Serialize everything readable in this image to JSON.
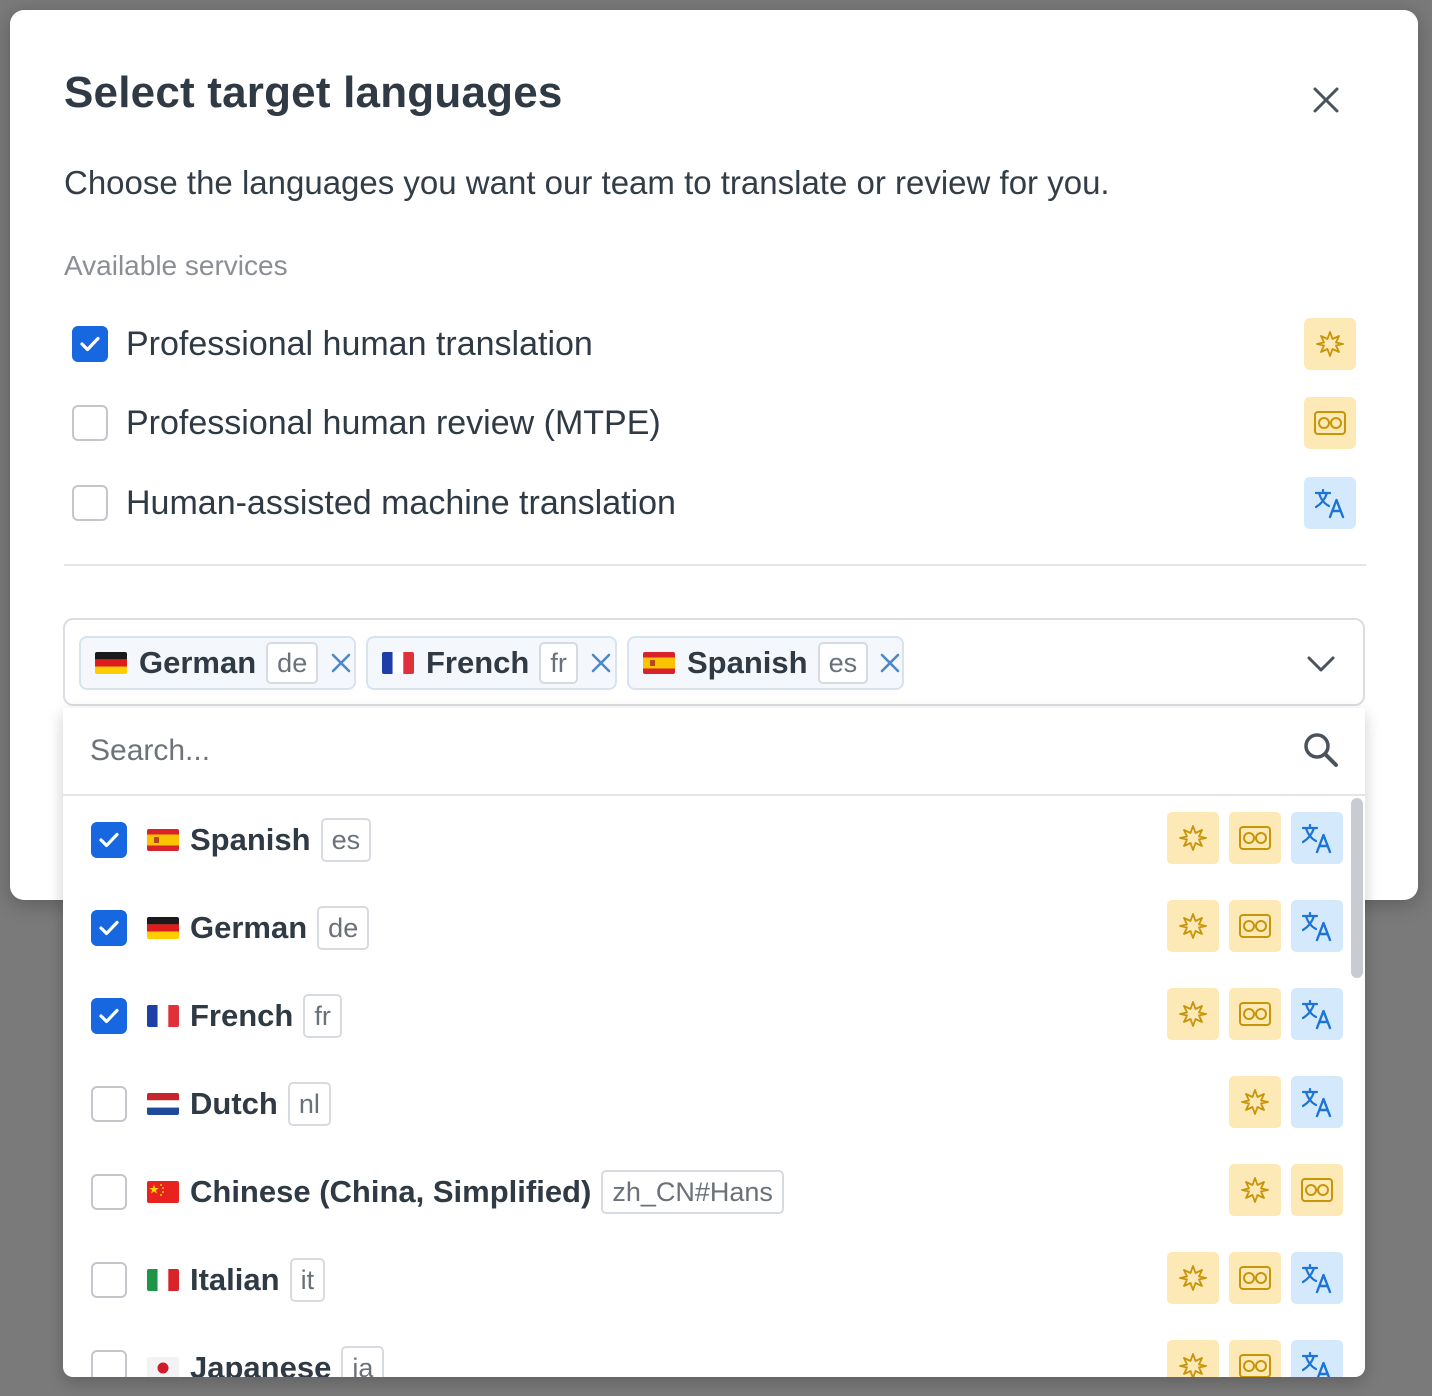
{
  "modal": {
    "title": "Select target languages",
    "subtitle": "Choose the languages you want our team to translate or review for you.",
    "services_label": "Available services",
    "services": [
      {
        "label": "Professional human translation",
        "checked": true,
        "icon": "sparkle-icon",
        "badge_color": "#fde9b5"
      },
      {
        "label": "Professional human review (MTPE)",
        "checked": false,
        "icon": "review-glasses-icon",
        "badge_color": "#fde9b5"
      },
      {
        "label": "Human-assisted machine translation",
        "checked": false,
        "icon": "translate-icon",
        "badge_color": "#d4e9fb"
      }
    ]
  },
  "selected_chips": [
    {
      "name": "German",
      "code": "de",
      "flag": "de-flag-icon"
    },
    {
      "name": "French",
      "code": "fr",
      "flag": "fr-flag-icon"
    },
    {
      "name": "Spanish",
      "code": "es",
      "flag": "es-flag-icon"
    }
  ],
  "search": {
    "placeholder": "Search..."
  },
  "languages": [
    {
      "name": "Spanish",
      "code": "es",
      "checked": true,
      "flag": "es-flag-icon",
      "services": [
        "sparkle-icon",
        "review-glasses-icon",
        "translate-icon"
      ]
    },
    {
      "name": "German",
      "code": "de",
      "checked": true,
      "flag": "de-flag-icon",
      "services": [
        "sparkle-icon",
        "review-glasses-icon",
        "translate-icon"
      ]
    },
    {
      "name": "French",
      "code": "fr",
      "checked": true,
      "flag": "fr-flag-icon",
      "services": [
        "sparkle-icon",
        "review-glasses-icon",
        "translate-icon"
      ]
    },
    {
      "name": "Dutch",
      "code": "nl",
      "checked": false,
      "flag": "nl-flag-icon",
      "services": [
        "sparkle-icon",
        "translate-icon"
      ]
    },
    {
      "name": "Chinese (China, Simplified)",
      "code": "zh_CN#Hans",
      "checked": false,
      "flag": "cn-flag-icon",
      "services": [
        "sparkle-icon",
        "review-glasses-icon"
      ]
    },
    {
      "name": "Italian",
      "code": "it",
      "checked": false,
      "flag": "it-flag-icon",
      "services": [
        "sparkle-icon",
        "review-glasses-icon",
        "translate-icon"
      ]
    },
    {
      "name": "Japanese",
      "code": "ja",
      "checked": false,
      "flag": "jp-flag-icon",
      "services": [
        "sparkle-icon",
        "review-glasses-icon",
        "translate-icon"
      ]
    }
  ],
  "colors": {
    "accent": "#1667e0",
    "yellow_badge": "#fde9b5",
    "blue_badge": "#d4e9fb",
    "yellow_icon": "#c8940a",
    "blue_icon": "#1d74d6"
  }
}
